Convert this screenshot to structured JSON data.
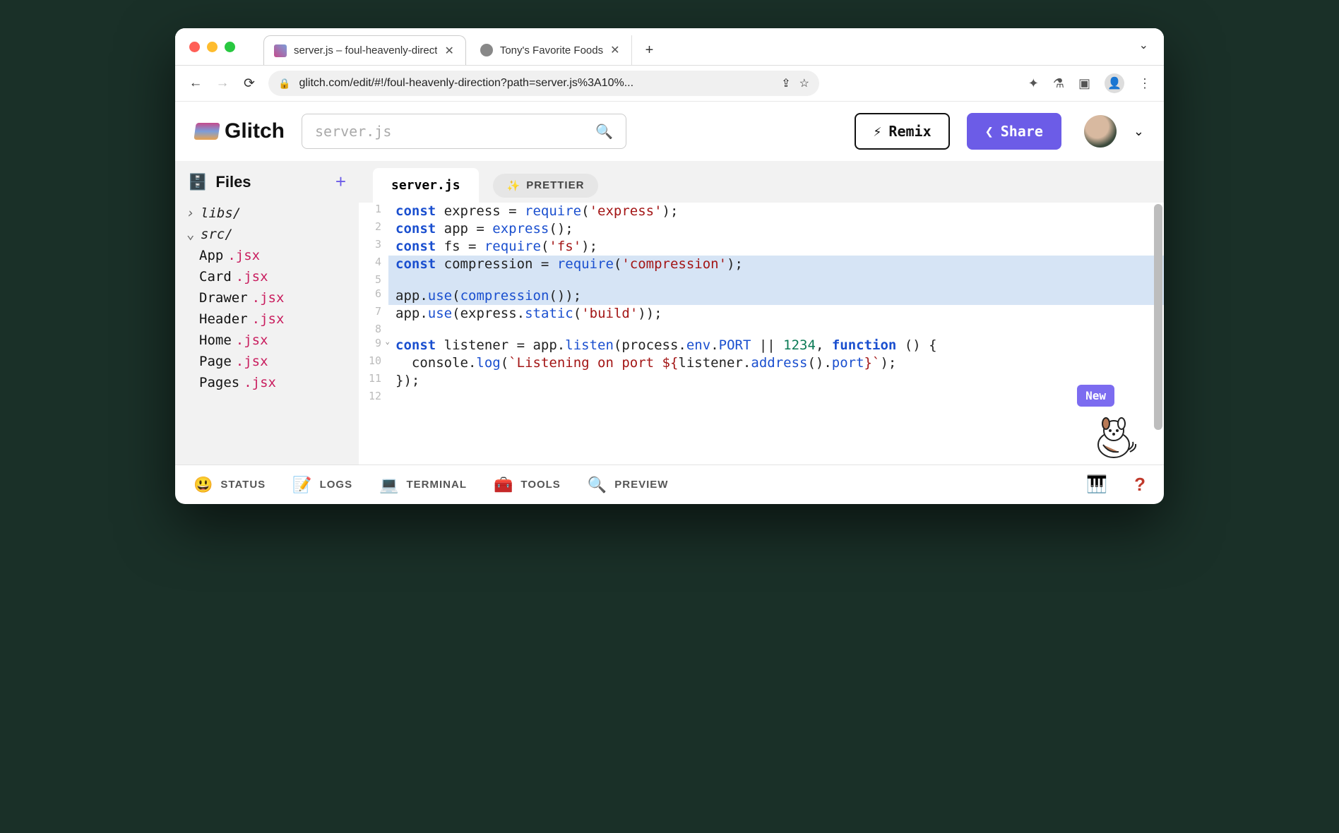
{
  "browser": {
    "tabs": [
      {
        "title": "server.js – foul-heavenly-direct",
        "active": true
      },
      {
        "title": "Tony's Favorite Foods",
        "active": false
      }
    ],
    "url": "glitch.com/edit/#!/foul-heavenly-direction?path=server.js%3A10%..."
  },
  "header": {
    "logo": "Glitch",
    "search_placeholder": "server.js",
    "remix_label": "Remix",
    "share_label": "Share"
  },
  "sidebar": {
    "title": "Files",
    "folders": [
      {
        "name": "libs/",
        "expanded": false
      },
      {
        "name": "src/",
        "expanded": true
      }
    ],
    "files": [
      {
        "base": "App",
        "ext": ".jsx"
      },
      {
        "base": "Card",
        "ext": ".jsx"
      },
      {
        "base": "Drawer",
        "ext": ".jsx"
      },
      {
        "base": "Header",
        "ext": ".jsx"
      },
      {
        "base": "Home",
        "ext": ".jsx"
      },
      {
        "base": "Page",
        "ext": ".jsx"
      },
      {
        "base": "Pages",
        "ext": ".jsx"
      }
    ]
  },
  "editor": {
    "active_tab": "server.js",
    "prettier_label": "PRETTIER",
    "new_badge": "New",
    "lines": [
      {
        "n": 1,
        "hl": false,
        "tokens": [
          [
            "kw",
            "const"
          ],
          [
            "op",
            " express "
          ],
          [
            "op",
            "= "
          ],
          [
            "fn",
            "require"
          ],
          [
            "punct",
            "("
          ],
          [
            "str",
            "'express'"
          ],
          [
            "punct",
            ");"
          ]
        ]
      },
      {
        "n": 2,
        "hl": false,
        "tokens": [
          [
            "kw",
            "const"
          ],
          [
            "op",
            " app "
          ],
          [
            "op",
            "= "
          ],
          [
            "fn",
            "express"
          ],
          [
            "punct",
            "();"
          ]
        ]
      },
      {
        "n": 3,
        "hl": false,
        "tokens": [
          [
            "kw",
            "const"
          ],
          [
            "op",
            " fs "
          ],
          [
            "op",
            "= "
          ],
          [
            "fn",
            "require"
          ],
          [
            "punct",
            "("
          ],
          [
            "str",
            "'fs'"
          ],
          [
            "punct",
            ");"
          ]
        ]
      },
      {
        "n": 4,
        "hl": true,
        "tokens": [
          [
            "kw",
            "const"
          ],
          [
            "op",
            " compression "
          ],
          [
            "op",
            "= "
          ],
          [
            "fn",
            "require"
          ],
          [
            "punct",
            "("
          ],
          [
            "str",
            "'compression'"
          ],
          [
            "punct",
            ");"
          ]
        ]
      },
      {
        "n": 5,
        "hl": true,
        "tokens": [
          [
            "op",
            ""
          ]
        ]
      },
      {
        "n": 6,
        "hl": true,
        "tokens": [
          [
            "op",
            "app"
          ],
          [
            "punct",
            "."
          ],
          [
            "prop",
            "use"
          ],
          [
            "punct",
            "("
          ],
          [
            "fn",
            "compression"
          ],
          [
            "punct",
            "());"
          ]
        ]
      },
      {
        "n": 7,
        "hl": false,
        "tokens": [
          [
            "op",
            "app"
          ],
          [
            "punct",
            "."
          ],
          [
            "prop",
            "use"
          ],
          [
            "punct",
            "("
          ],
          [
            "op",
            "express"
          ],
          [
            "punct",
            "."
          ],
          [
            "prop",
            "static"
          ],
          [
            "punct",
            "("
          ],
          [
            "str",
            "'build'"
          ],
          [
            "punct",
            "));"
          ]
        ]
      },
      {
        "n": 8,
        "hl": false,
        "tokens": [
          [
            "op",
            ""
          ]
        ]
      },
      {
        "n": 9,
        "hl": false,
        "fold": true,
        "tokens": [
          [
            "kw",
            "const"
          ],
          [
            "op",
            " listener "
          ],
          [
            "op",
            "= app"
          ],
          [
            "punct",
            "."
          ],
          [
            "prop",
            "listen"
          ],
          [
            "punct",
            "(process"
          ],
          [
            "punct",
            "."
          ],
          [
            "prop",
            "env"
          ],
          [
            "punct",
            "."
          ],
          [
            "prop",
            "PORT"
          ],
          [
            "op",
            " || "
          ],
          [
            "num",
            "1234"
          ],
          [
            "punct",
            ", "
          ],
          [
            "kw",
            "function"
          ],
          [
            "punct",
            " () {"
          ]
        ]
      },
      {
        "n": 10,
        "hl": false,
        "tokens": [
          [
            "op",
            "  console"
          ],
          [
            "punct",
            "."
          ],
          [
            "prop",
            "log"
          ],
          [
            "punct",
            "("
          ],
          [
            "str",
            "`Listening on port ${"
          ],
          [
            "op",
            "listener"
          ],
          [
            "punct",
            "."
          ],
          [
            "prop",
            "address"
          ],
          [
            "punct",
            "()."
          ],
          [
            "prop",
            "port"
          ],
          [
            "str",
            "}`"
          ],
          [
            "punct",
            ");"
          ]
        ]
      },
      {
        "n": 11,
        "hl": false,
        "tokens": [
          [
            "punct",
            "});"
          ]
        ]
      },
      {
        "n": 12,
        "hl": false,
        "tokens": [
          [
            "op",
            ""
          ]
        ]
      }
    ]
  },
  "bottombar": {
    "items": [
      {
        "icon": "😃",
        "label": "STATUS"
      },
      {
        "icon": "📝",
        "label": "LOGS"
      },
      {
        "icon": "💻",
        "label": "TERMINAL"
      },
      {
        "icon": "🧰",
        "label": "TOOLS"
      },
      {
        "icon": "🔍",
        "label": "PREVIEW"
      }
    ],
    "help": "?"
  }
}
